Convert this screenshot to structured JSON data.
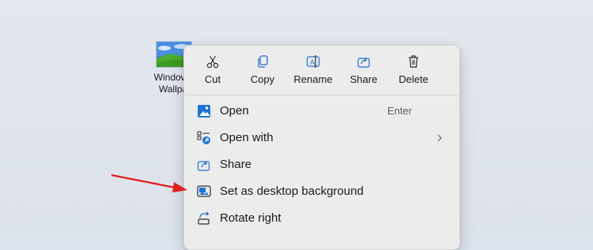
{
  "desktop": {
    "icon": {
      "label": "Windows\nWallpa",
      "thumbnail": "windows-xp-bliss-wallpaper-thumbnail"
    }
  },
  "context_menu": {
    "toolbar": [
      {
        "label": "Cut",
        "icon": "scissors-icon"
      },
      {
        "label": "Copy",
        "icon": "copy-icon"
      },
      {
        "label": "Rename",
        "icon": "rename-icon"
      },
      {
        "label": "Share",
        "icon": "share-icon"
      },
      {
        "label": "Delete",
        "icon": "trash-icon"
      }
    ],
    "items": [
      {
        "label": "Open",
        "shortcut": "Enter",
        "icon": "open-image-icon"
      },
      {
        "label": "Open with",
        "icon": "open-with-icon",
        "submenu": true
      },
      {
        "label": "Share",
        "icon": "share-icon"
      },
      {
        "label": "Set as desktop background",
        "icon": "desktop-background-icon"
      },
      {
        "label": "Rotate right",
        "icon": "rotate-right-icon"
      }
    ]
  },
  "annotation": {
    "arrow_color": "#e02020",
    "target": "Set as desktop background"
  },
  "colors": {
    "menu_bg": "#ececec",
    "desktop_bg": "#dfe4ec",
    "accent_blue": "#1a73d9"
  }
}
